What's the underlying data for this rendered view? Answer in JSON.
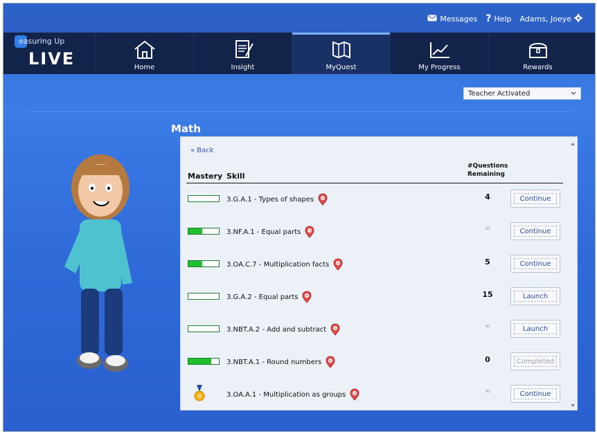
{
  "topbar": {
    "messages": "Messages",
    "help": "Help",
    "user": "Adams, Joeye"
  },
  "brand": {
    "line1": "easuring Up",
    "line2": "LIVE"
  },
  "nav": {
    "items": [
      {
        "label": "Home",
        "icon": "home-icon"
      },
      {
        "label": "Insight",
        "icon": "notepad-icon"
      },
      {
        "label": "MyQuest",
        "icon": "map-icon"
      },
      {
        "label": "My Progress",
        "icon": "chart-icon"
      },
      {
        "label": "Rewards",
        "icon": "treasure-chest-icon"
      }
    ],
    "active": "MyQuest"
  },
  "filter": {
    "value": "Teacher Activated"
  },
  "page": {
    "title": "Math"
  },
  "panel": {
    "back": "« Back",
    "headers": {
      "mastery": "Mastery",
      "skill": "Skill",
      "remaining_line1": "#Questions",
      "remaining_line2": "Remaining"
    },
    "rows": [
      {
        "skill": "3.G.A.1 - Types of shapes",
        "mastery": 0.0,
        "remaining": "4",
        "action": "Continue",
        "disabled": false
      },
      {
        "skill": "3.NF.A.1 - Equal parts",
        "mastery": 0.45,
        "remaining": "∞",
        "action": "Continue",
        "disabled": false
      },
      {
        "skill": "3.OA.C.7 - Multiplication facts",
        "mastery": 0.45,
        "remaining": "5",
        "action": "Continue",
        "disabled": false
      },
      {
        "skill": "3.G.A.2 - Equal parts",
        "mastery": 0.0,
        "remaining": "15",
        "action": "Launch",
        "disabled": false
      },
      {
        "skill": "3.NBT.A.2 - Add and subtract",
        "mastery": 0.0,
        "remaining": "∞",
        "action": "Launch",
        "disabled": false
      },
      {
        "skill": "3.NBT.A.1 - Round numbers",
        "mastery": 0.75,
        "remaining": "0",
        "action": "Completed",
        "disabled": true
      },
      {
        "skill": "3.OA.A.1 - Multiplication as groups",
        "mastery": "medal",
        "remaining": "∞",
        "action": "Continue",
        "disabled": false
      }
    ]
  },
  "colors": {
    "accent": "#2f6fd6",
    "nav_bg": "#12244a",
    "bar_fill": "#1fbf2d",
    "pin": "#e24b4b"
  }
}
